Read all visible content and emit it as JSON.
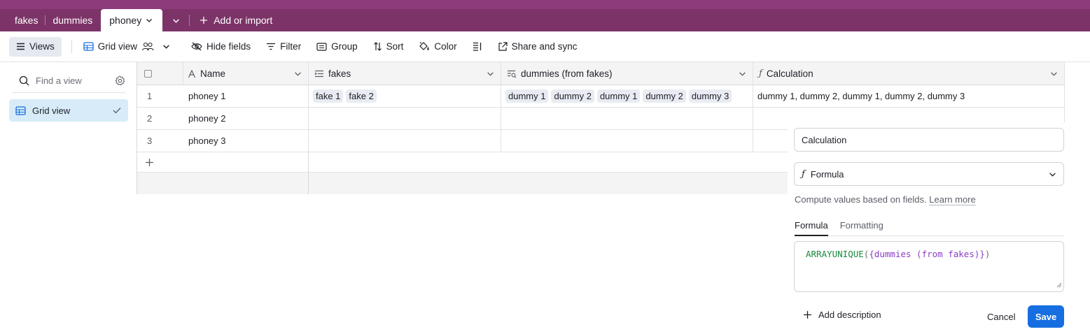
{
  "colors": {
    "tabbar": "#7c3468",
    "topstrip": "#8e3b7b",
    "accent": "#166ee1",
    "selected": "#d7ecf8"
  },
  "tabs": [
    {
      "label": "fakes"
    },
    {
      "label": "dummies"
    },
    {
      "label": "phoney",
      "active": true
    }
  ],
  "tabbar": {
    "add_label": "Add or import"
  },
  "toolbar": {
    "views_label": "Views",
    "view_name": "Grid view",
    "hide_fields": "Hide fields",
    "filter": "Filter",
    "group": "Group",
    "sort": "Sort",
    "color": "Color",
    "share": "Share and sync"
  },
  "sidebar": {
    "search_placeholder": "Find a view",
    "items": [
      {
        "label": "Grid view",
        "icon": "grid-icon",
        "selected": true
      }
    ]
  },
  "grid": {
    "columns": [
      {
        "label": "Name",
        "icon": "text-icon"
      },
      {
        "label": "fakes",
        "icon": "link-icon"
      },
      {
        "label": "dummies (from fakes)",
        "icon": "lookup-icon"
      },
      {
        "label": "Calculation",
        "icon": "formula-icon"
      }
    ],
    "rows": [
      {
        "num": "1",
        "name": "phoney 1",
        "fakes": [
          "fake 1",
          "fake 2"
        ],
        "dummies": [
          "dummy 1",
          "dummy 2",
          "dummy 1",
          "dummy 2",
          "dummy 3"
        ],
        "calc": "dummy 1, dummy 2, dummy 1, dummy 2, dummy 3"
      },
      {
        "num": "2",
        "name": "phoney 2",
        "fakes": [],
        "dummies": [],
        "calc": ""
      },
      {
        "num": "3",
        "name": "phoney 3",
        "fakes": [],
        "dummies": [],
        "calc": ""
      }
    ]
  },
  "panel": {
    "field_name": "Calculation",
    "field_type": "Formula",
    "description": "Compute values based on fields.",
    "learn_more": "Learn more",
    "tabs": [
      "Formula",
      "Formatting"
    ],
    "formula_fn": "ARRAYUNIQUE",
    "formula_open": "(",
    "formula_field": "{dummies (from fakes)}",
    "formula_close": ")",
    "add_description": "Add description",
    "cancel": "Cancel",
    "save": "Save"
  }
}
